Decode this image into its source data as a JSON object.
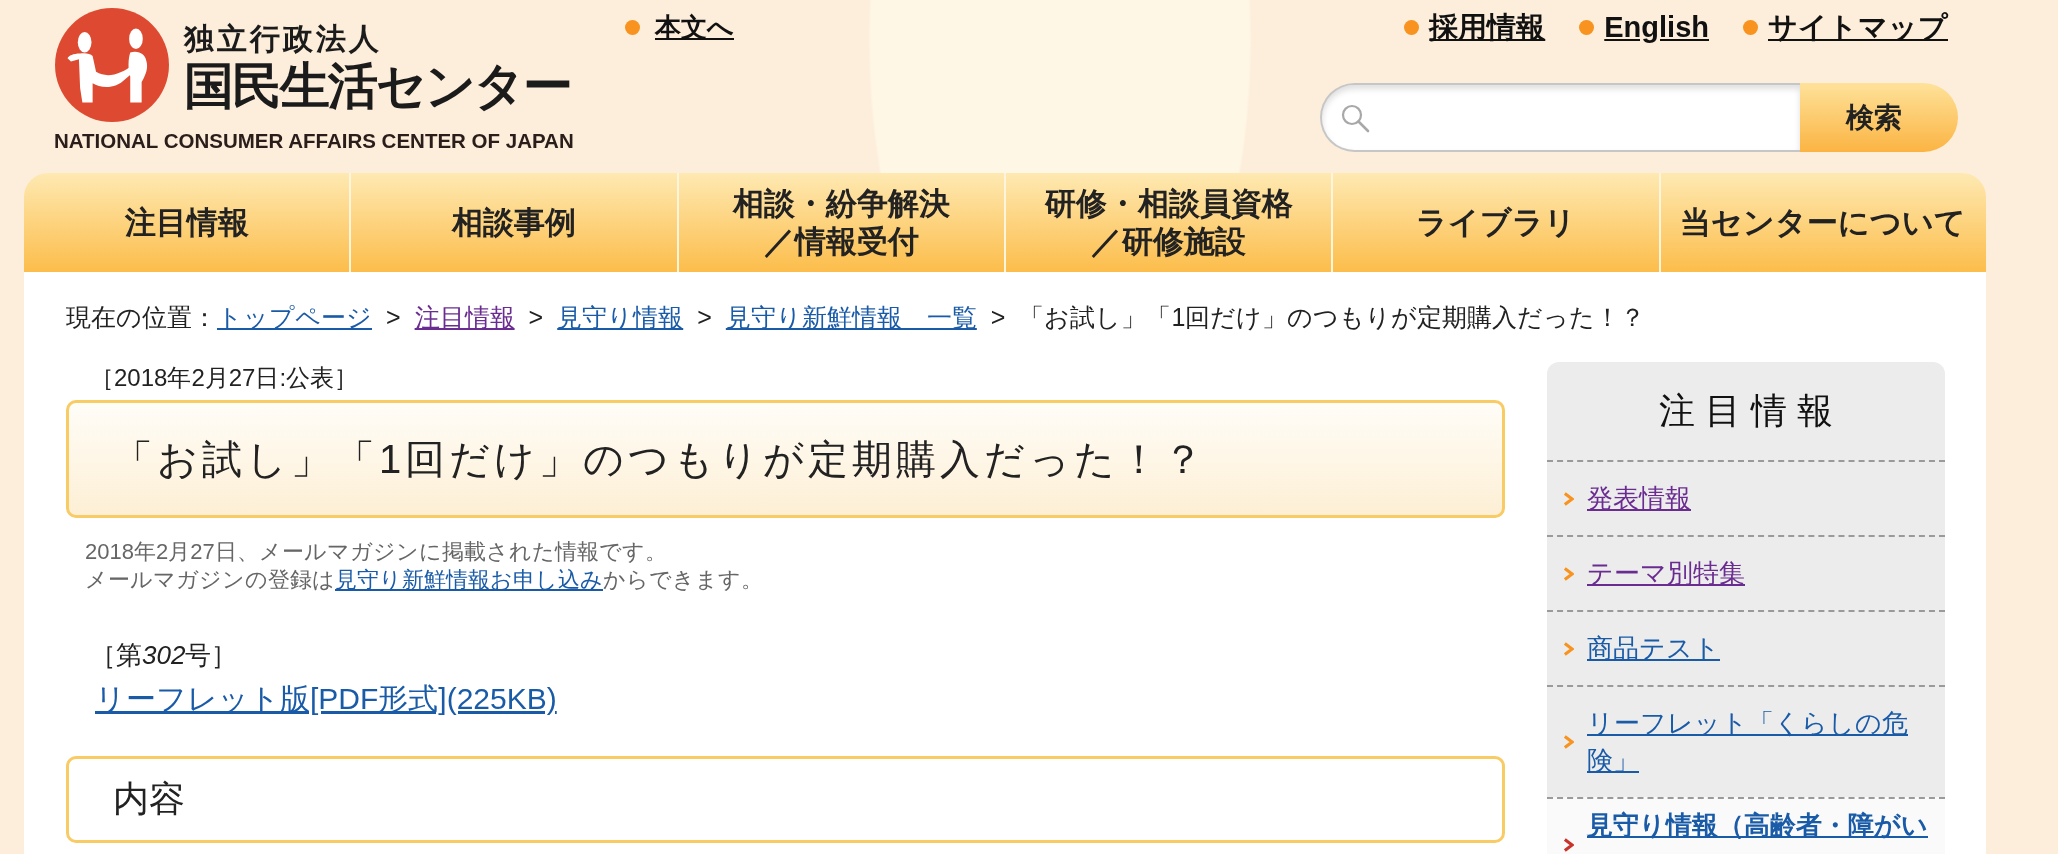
{
  "header": {
    "logo": {
      "org_type": "独立行政法人",
      "name": "国民生活センター",
      "english_name": "NATIONAL CONSUMER AFFAIRS CENTER OF JAPAN"
    },
    "skip_link": "本文へ",
    "utility_links": [
      "採用情報",
      "English",
      "サイトマップ"
    ],
    "search": {
      "button": "検索"
    }
  },
  "nav": {
    "tabs": [
      {
        "lines": [
          "注目情報"
        ]
      },
      {
        "lines": [
          "相談事例"
        ]
      },
      {
        "lines": [
          "相談・紛争解決",
          "／情報受付"
        ]
      },
      {
        "lines": [
          "研修・相談員資格",
          "／研修施設"
        ]
      },
      {
        "lines": [
          "ライブラリ"
        ]
      },
      {
        "lines": [
          "当センターについて"
        ]
      }
    ]
  },
  "breadcrumb": {
    "label": "現在の位置：",
    "separator": ">",
    "links": [
      {
        "text": "トップページ",
        "visited": false
      },
      {
        "text": "注目情報",
        "visited": true
      },
      {
        "text": "見守り情報",
        "visited": false
      },
      {
        "text": "見守り新鮮情報　一覧",
        "visited": false
      }
    ],
    "current": "「お試し」「1回だけ」のつもりが定期購入だった！？"
  },
  "article": {
    "date": "［2018年2月27日:公表］",
    "title": "「お試し」「1回だけ」のつもりが定期購入だった！？",
    "notes": {
      "line_1": "2018年2月27日、メールマガジンに掲載された情報です。",
      "line_2": {
        "before": "メールマガジンの登録は",
        "link": "見守り新鮮情報お申し込み",
        "after": "からできます。"
      }
    },
    "issue": {
      "before": "［第",
      "number": "302",
      "after": "号］"
    },
    "leaflet_link": "リーフレット版[PDF形式](225KB)",
    "section_heading": "内容"
  },
  "sidebar": {
    "title": "注目情報",
    "items": [
      {
        "text": "発表情報",
        "visited": true,
        "selected": false
      },
      {
        "text": "テーマ別特集",
        "visited": true,
        "selected": false
      },
      {
        "text": "商品テスト",
        "visited": false,
        "selected": false
      },
      {
        "text": "リーフレット「くらしの危険」",
        "visited": false,
        "selected": false
      },
      {
        "text": "見守り情報（高齢者・障がい",
        "visited": false,
        "selected": true
      }
    ]
  }
}
